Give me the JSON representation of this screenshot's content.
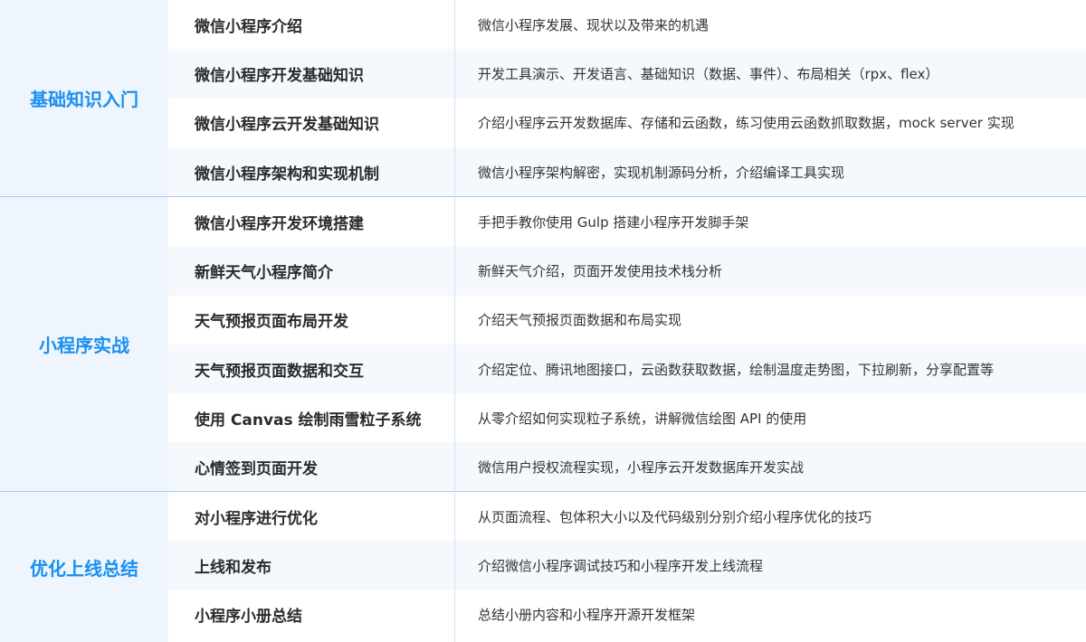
{
  "sections": [
    {
      "title": "基础知识入门",
      "rows": [
        {
          "topic": "微信小程序介绍",
          "desc": "微信小程序发展、现状以及带来的机遇"
        },
        {
          "topic": "微信小程序开发基础知识",
          "desc": "开发工具演示、开发语言、基础知识（数据、事件）、布局相关（rpx、flex）"
        },
        {
          "topic": "微信小程序云开发基础知识",
          "desc": "介绍小程序云开发数据库、存储和云函数，练习使用云函数抓取数据，mock server 实现"
        },
        {
          "topic": "微信小程序架构和实现机制",
          "desc": "微信小程序架构解密，实现机制源码分析，介绍编译工具实现"
        }
      ]
    },
    {
      "title": "小程序实战",
      "rows": [
        {
          "topic": "微信小程序开发环境搭建",
          "desc": "手把手教你使用 Gulp 搭建小程序开发脚手架"
        },
        {
          "topic": "新鲜天气小程序简介",
          "desc": "新鲜天气介绍，页面开发使用技术栈分析"
        },
        {
          "topic": "天气预报页面布局开发",
          "desc": "介绍天气预报页面数据和布局实现"
        },
        {
          "topic": "天气预报页面数据和交互",
          "desc": "介绍定位、腾讯地图接口，云函数获取数据，绘制温度走势图，下拉刷新，分享配置等"
        },
        {
          "topic": "使用 Canvas 绘制雨雪粒子系统",
          "desc": "从零介绍如何实现粒子系统，讲解微信绘图 API 的使用"
        },
        {
          "topic": "心情签到页面开发",
          "desc": "微信用户授权流程实现，小程序云开发数据库开发实战"
        }
      ]
    },
    {
      "title": "优化上线总结",
      "rows": [
        {
          "topic": "对小程序进行优化",
          "desc": "从页面流程、包体积大小以及代码级别分别介绍小程序优化的技巧"
        },
        {
          "topic": "上线和发布",
          "desc": "介绍微信小程序调试技巧和小程序开发上线流程"
        },
        {
          "topic": "小程序小册总结",
          "desc": "总结小册内容和小程序开源开发框架"
        }
      ]
    }
  ]
}
